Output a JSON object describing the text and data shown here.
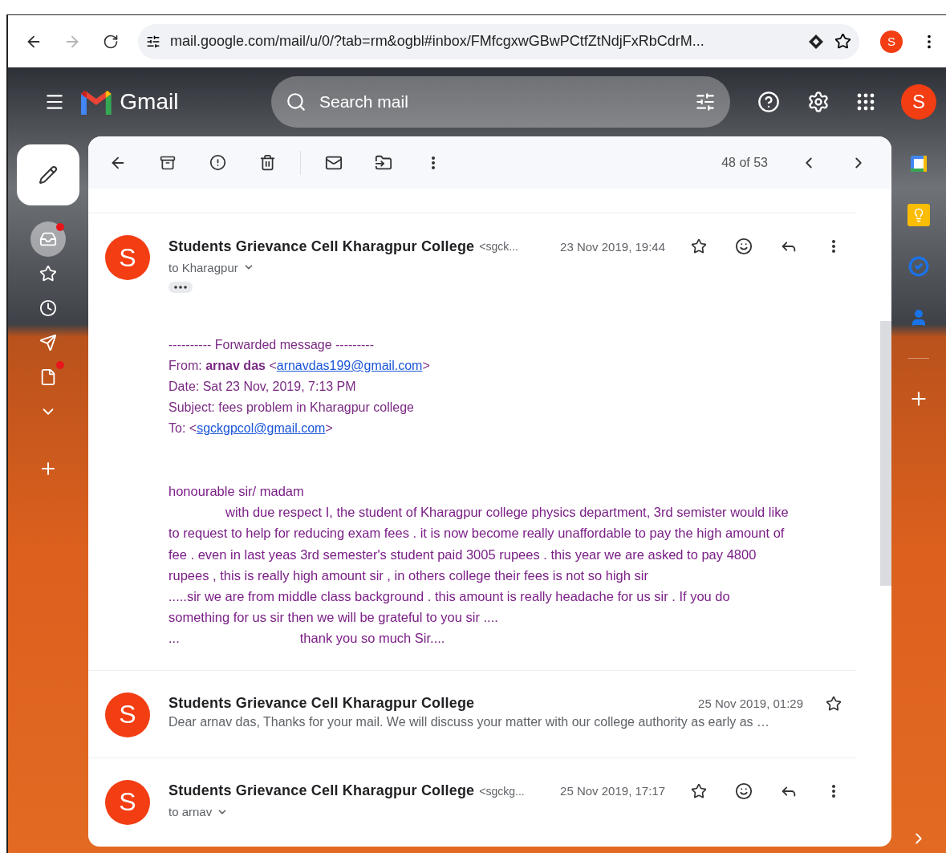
{
  "browser": {
    "nav": [
      {
        "kind": "back",
        "disabled": false
      },
      {
        "kind": "forward",
        "disabled": true
      },
      {
        "kind": "reload",
        "disabled": false
      }
    ],
    "url": "mail.google.com/mail/u/0/?tab=rm&ogbl#inbox/FMfcgxwGBwPCtfZtNdjFxRbCdrM...",
    "profile_initial": "S"
  },
  "app": {
    "name": "Gmail",
    "search": {
      "placeholder": "Search mail"
    },
    "avatar_initial": "S"
  },
  "sidebar": {
    "items": [
      {
        "kind": "inbox",
        "selected": true,
        "badge": true
      },
      {
        "kind": "starred",
        "selected": false,
        "badge": false
      },
      {
        "kind": "snoozed",
        "selected": false,
        "badge": false
      },
      {
        "kind": "sent",
        "selected": false,
        "badge": false
      },
      {
        "kind": "drafts",
        "selected": false,
        "badge": true
      },
      {
        "kind": "more",
        "selected": false,
        "badge": false
      }
    ]
  },
  "toolbar": {
    "count": "48 of 53"
  },
  "messages": [
    {
      "kind": "expanded",
      "avatar": "S",
      "sender": "Students Grievance Cell Kharagpur College",
      "email": "<sgck...",
      "date": "23 Nov 2019, 19:44",
      "to": "to Kharagpur",
      "forward": {
        "title": "---------- Forwarded message ---------",
        "from": {
          "prefix": "From: **arnav das** <",
          "email": "arnavdas199@gmail.com",
          "suffix": ">"
        },
        "date": "Date: Sat 23 Nov, 2019, 7:13 PM",
        "subject": "Subject: fees problem in Kharagpur college",
        "to": {
          "prefix": "To: <",
          "email": "sgckgpcol@gmail.com",
          "suffix": ">"
        }
      },
      "body": {
        "greeting": "honourable sir/ madam",
        "paragraph": "with due respect I, the student of Kharagpur college physics department, 3rd semister would like\nto request to help for reducing exam fees . it is now become really unaffordable to pay the high amount of\nfee . even in last yeas 3rd semester's student paid 3005 rupees . this year we are asked to pay 4800\nrupees , this is really high amount sir , in others college their fees is not so high sir",
        "appeal": ".....sir we are from middle class background . this amount is really headache for us sir . If you do\nsomething for us sir then we will be grateful to you sir ....",
        "closing_dots": "...",
        "closing": "thank you so much Sir...."
      }
    },
    {
      "kind": "collapsed",
      "avatar": "S",
      "sender": "Students Grievance Cell Kharagpur College",
      "date": "25 Nov 2019, 01:29",
      "snippet": "Dear arnav das, Thanks for your mail. We will discuss your matter with our college authority as early as …"
    },
    {
      "kind": "expanded",
      "avatar": "S",
      "sender": "Students Grievance Cell Kharagpur College",
      "email": "<sgckg...",
      "date": "25 Nov 2019, 17:17",
      "to": "to arnav"
    }
  ]
}
